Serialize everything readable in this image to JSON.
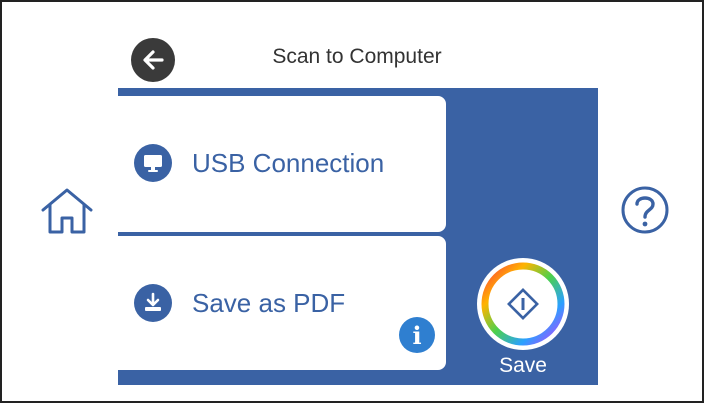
{
  "header": {
    "title": "Scan to Computer",
    "back_icon": "arrow-left-icon"
  },
  "nav": {
    "home_icon": "home-icon",
    "help_icon": "help-icon"
  },
  "options": [
    {
      "label": "USB Connection",
      "icon": "monitor-icon"
    },
    {
      "label": "Save as PDF",
      "icon": "download-icon"
    }
  ],
  "info_icon": "info-icon",
  "save": {
    "label": "Save",
    "icon": "start-diamond-icon"
  },
  "colors": {
    "panel_blue": "#3a62a4",
    "info_blue": "#2f7fd0",
    "back_dark": "#3a3a3a"
  }
}
